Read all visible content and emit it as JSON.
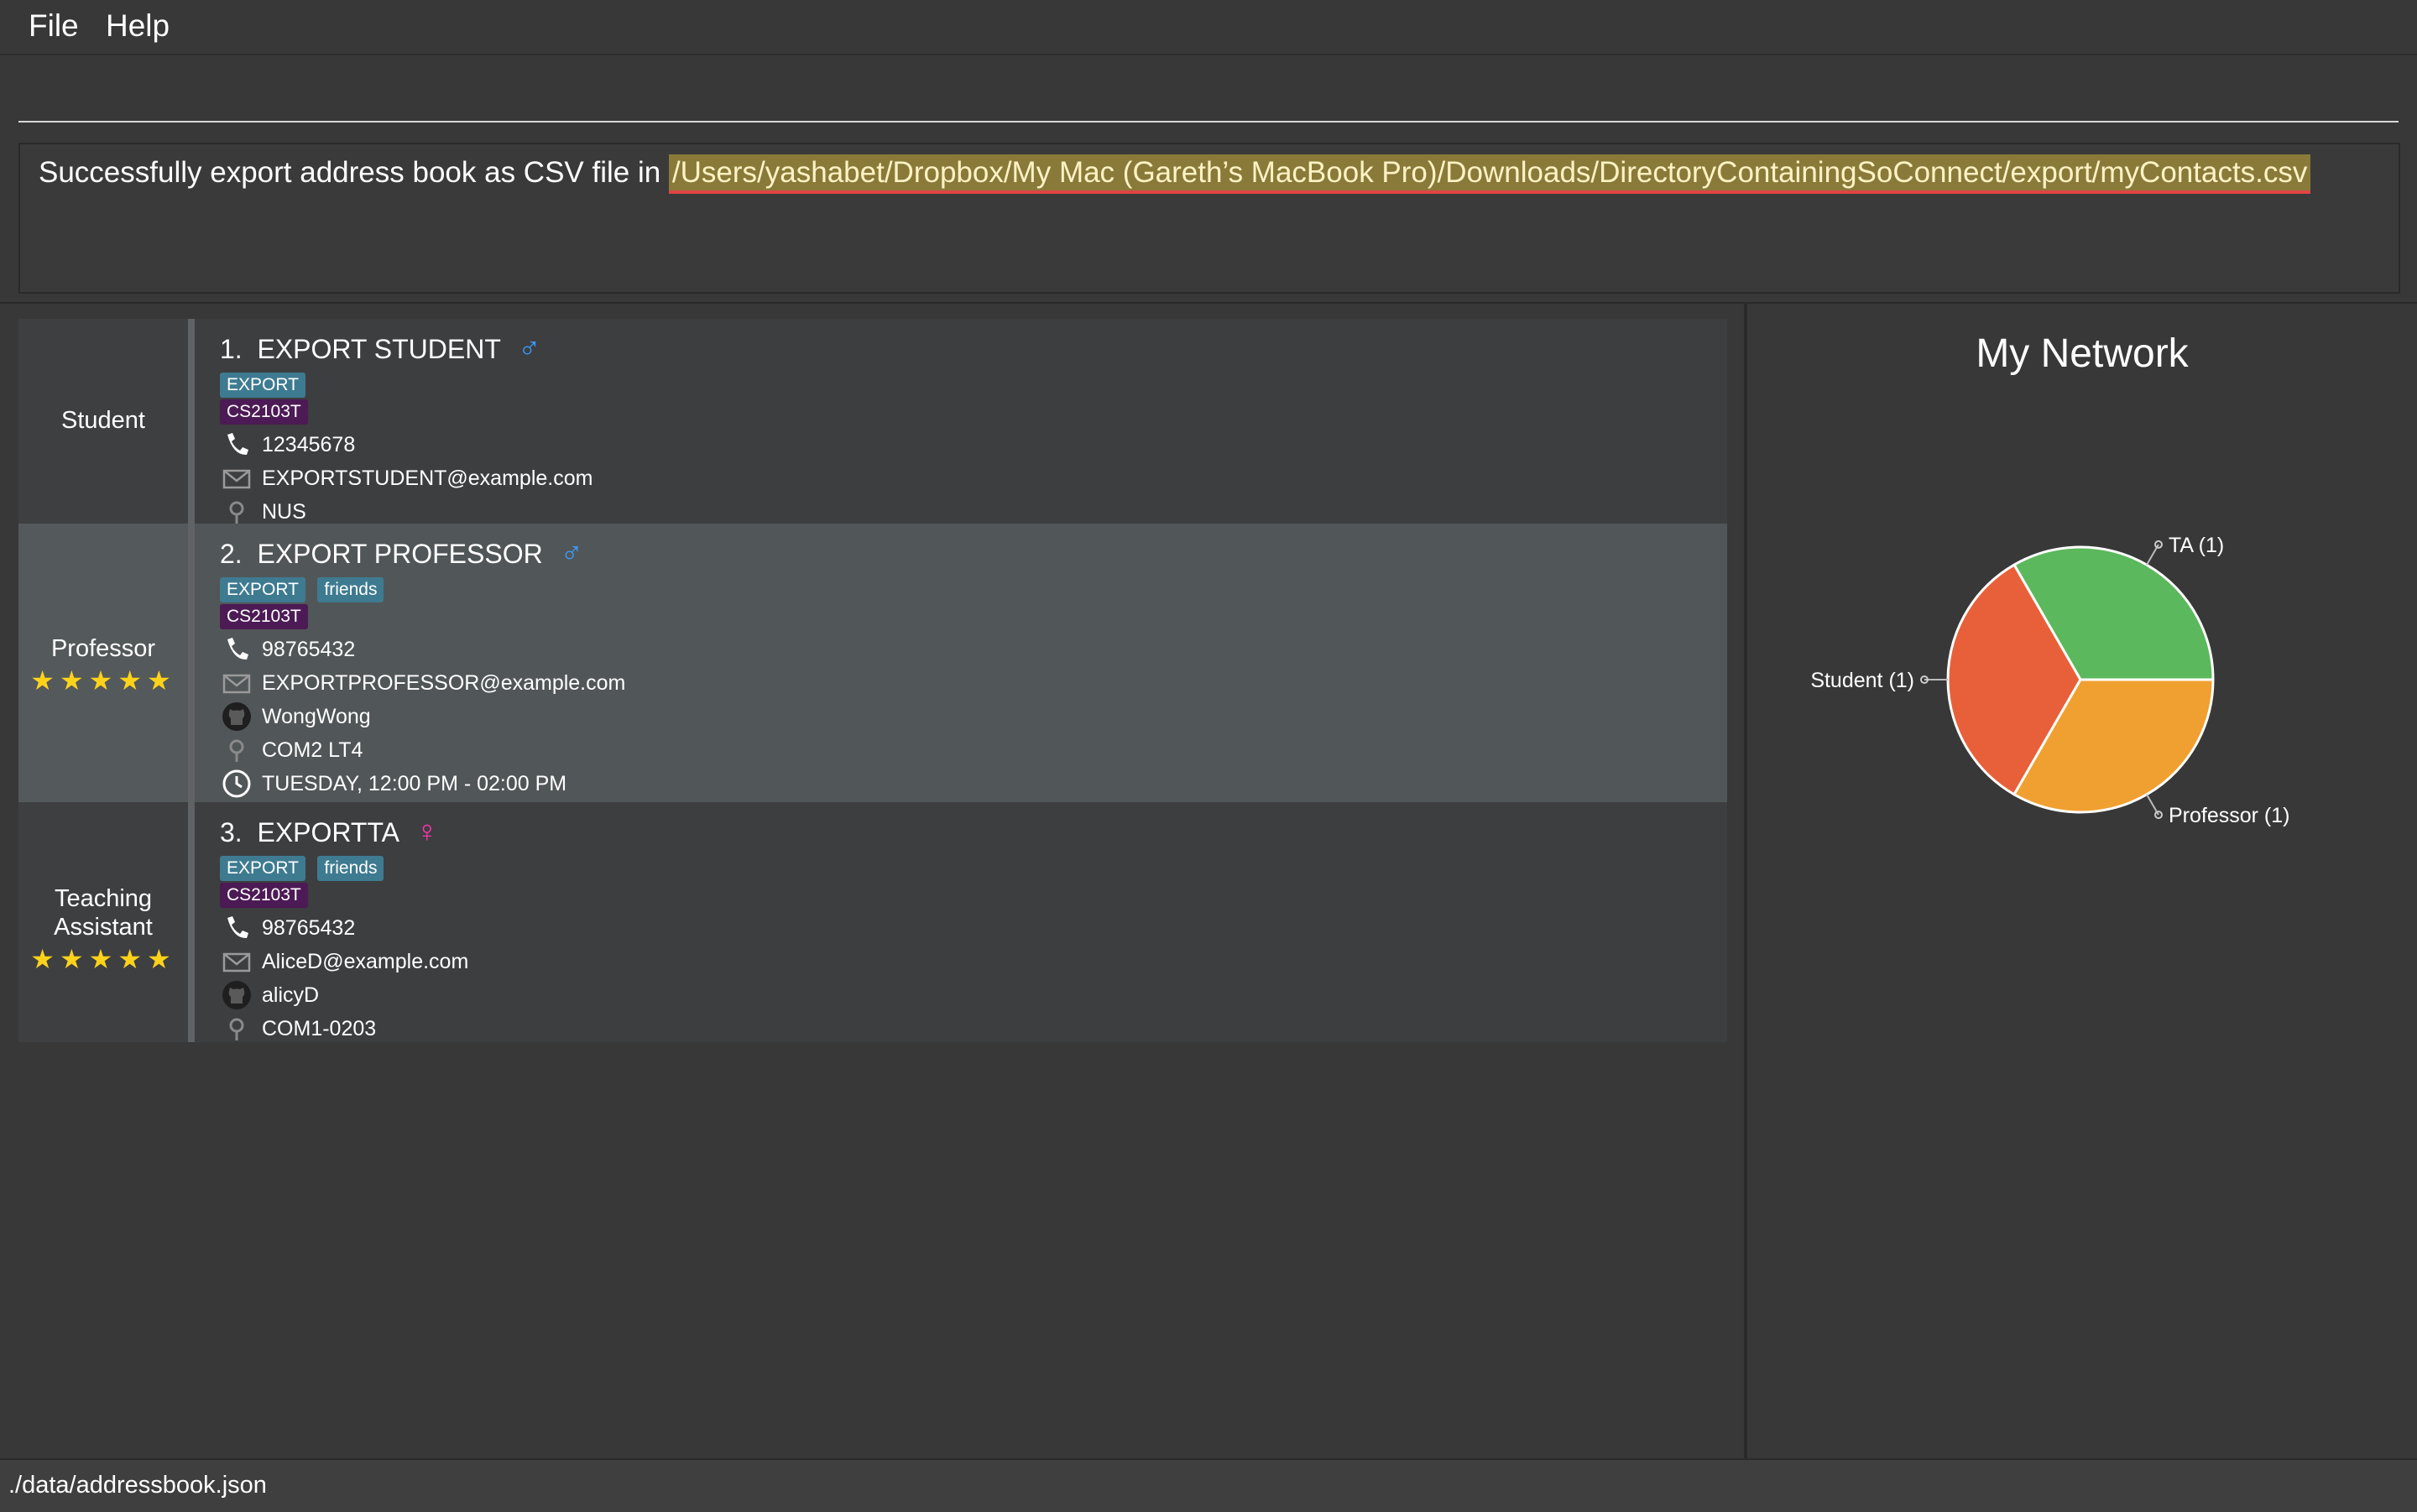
{
  "menu": {
    "file": "File",
    "help": "Help"
  },
  "command_box": {
    "value": ""
  },
  "result": {
    "prefix": "Successfully export address book as CSV file in ",
    "path": "/Users/yashabet/Dropbox/My Mac (Gareth’s MacBook Pro)/Downloads/DirectoryContainingSoConnect/export/myContacts.csv"
  },
  "contacts": [
    {
      "index": "1.",
      "name": "EXPORT STUDENT",
      "gender": "♂",
      "role": "Student",
      "tags": [
        "EXPORT"
      ],
      "module": "CS2103T",
      "phone": "12345678",
      "email": "EXPORTSTUDENT@example.com",
      "location": "NUS"
    },
    {
      "index": "2.",
      "name": "EXPORT PROFESSOR",
      "gender": "♂",
      "role": "Professor",
      "stars": "★★★★★",
      "rating": 5,
      "tags": [
        "EXPORT",
        "friends"
      ],
      "module": "CS2103T",
      "phone": "98765432",
      "email": "EXPORTPROFESSOR@example.com",
      "github": "WongWong",
      "location": "COM2 LT4",
      "office_hours": "TUESDAY, 12:00 PM - 02:00 PM"
    },
    {
      "index": "3.",
      "name": "EXPORTTA",
      "gender": "♀",
      "role_line1": "Teaching",
      "role_line2": "Assistant",
      "stars": "★★★★★",
      "rating": 5,
      "tags": [
        "EXPORT",
        "friends"
      ],
      "module": "CS2103T",
      "phone": "98765432",
      "email": "AliceD@example.com",
      "github": "alicyD",
      "location": "COM1-0203"
    }
  ],
  "chart_data": {
    "type": "pie",
    "title": "My Network",
    "slices": [
      {
        "label": "TA (1)",
        "value": 1,
        "color": "#5cb85c"
      },
      {
        "label": "Student (1)",
        "value": 1,
        "color": "#e8603a"
      },
      {
        "label": "Professor (1)",
        "value": 1,
        "color": "#f0a030"
      }
    ]
  },
  "status_bar": {
    "path": "./data/addressbook.json"
  },
  "colors": {
    "background": "#383838",
    "selected_card": "#515658",
    "tag": "#3e7b91",
    "module_tag": "#4c1a55",
    "star": "#ffd21a",
    "male": "#3b9dff",
    "female": "#ff33b0"
  }
}
